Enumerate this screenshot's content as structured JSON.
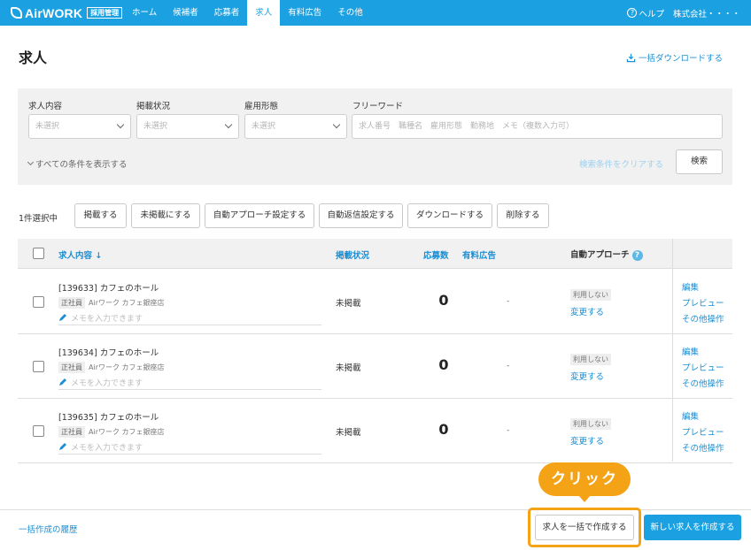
{
  "nav": {
    "logo_text": "AirWORK",
    "logo_badge": "採用管理",
    "items": [
      "ホーム",
      "候補者",
      "応募者",
      "求人",
      "有料広告",
      "その他"
    ],
    "active_index": 3,
    "help": "ヘルプ",
    "company": "株式会社・・・・"
  },
  "page": {
    "title": "求人",
    "bulk_download": "一括ダウンロードする"
  },
  "filter": {
    "job_content_label": "求人内容",
    "job_content_value": "未選択",
    "posting_status_label": "掲載状況",
    "posting_status_value": "未選択",
    "employment_type_label": "雇用形態",
    "employment_type_value": "未選択",
    "freeword_label": "フリーワード",
    "freeword_placeholder": "求人番号　職種名　雇用形態　勤務地　メモ（複数入力可）",
    "show_all": "すべての条件を表示する",
    "clear": "検索条件をクリアする",
    "search": "検索"
  },
  "actions": {
    "selected_count": "1件選択中",
    "buttons": [
      "掲載する",
      "未掲載にする",
      "自動アプローチ設定する",
      "自動返信設定する",
      "ダウンロードする",
      "削除する"
    ]
  },
  "table": {
    "headers": {
      "job": "求人内容",
      "sort_arrow": "↓",
      "status": "掲載状況",
      "applicants": "応募数",
      "paid_ad": "有料広告",
      "auto_approach": "自動アプローチ",
      "help": "?"
    },
    "rows": [
      {
        "title": "[139633] カフェのホール",
        "tag": "正社員",
        "store": "Airワーク カフェ銀座店",
        "memo_placeholder": "メモを入力できます",
        "status": "未掲載",
        "count": "0",
        "paid_ad": "-",
        "approach_badge": "利用しない",
        "approach_change": "変更する",
        "edit": "編集",
        "preview": "プレビュー",
        "other": "その他操作"
      },
      {
        "title": "[139634] カフェのホール",
        "tag": "正社員",
        "store": "Airワーク カフェ銀座店",
        "memo_placeholder": "メモを入力できます",
        "status": "未掲載",
        "count": "0",
        "paid_ad": "-",
        "approach_badge": "利用しない",
        "approach_change": "変更する",
        "edit": "編集",
        "preview": "プレビュー",
        "other": "その他操作"
      },
      {
        "title": "[139635] カフェのホール",
        "tag": "正社員",
        "store": "Airワーク カフェ銀座店",
        "memo_placeholder": "メモを入力できます",
        "status": "未掲載",
        "count": "0",
        "paid_ad": "-",
        "approach_badge": "利用しない",
        "approach_change": "変更する",
        "edit": "編集",
        "preview": "プレビュー",
        "other": "その他操作"
      }
    ]
  },
  "footer": {
    "history": "一括作成の履歴",
    "bulk_create": "求人を一括で作成する",
    "new_job": "新しい求人を作成する",
    "callout": "クリック"
  },
  "colors": {
    "brand": "#1ba1e2",
    "link": "#1b8ed3",
    "highlight": "#f5a316"
  }
}
